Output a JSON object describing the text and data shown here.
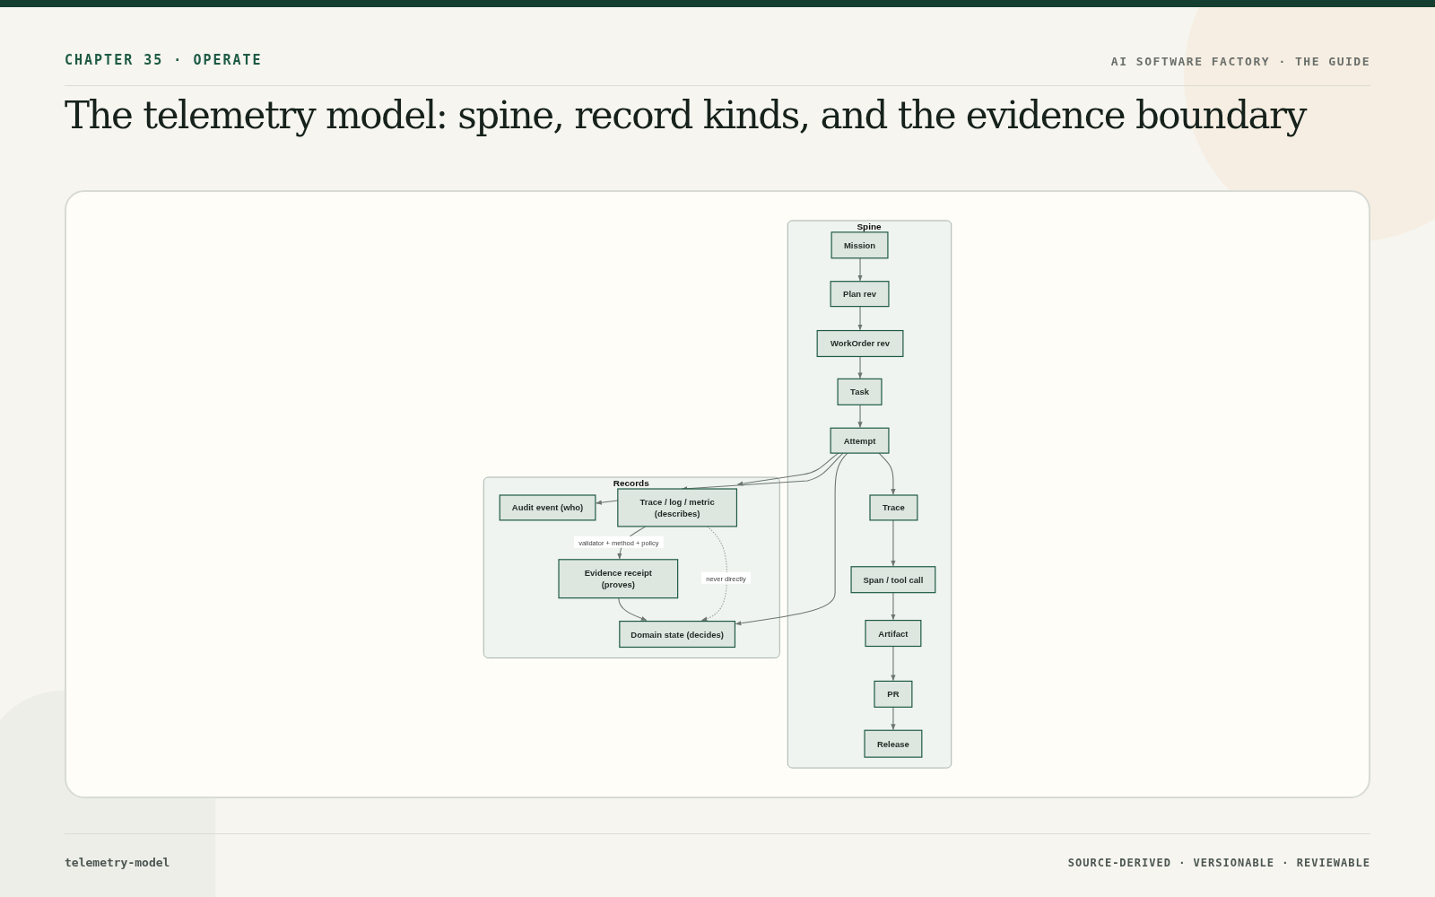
{
  "header": {
    "chapter": "CHAPTER 35 · OPERATE",
    "book": "AI SOFTWARE FACTORY · THE GUIDE"
  },
  "title": "The telemetry model: spine, record kinds, and the evidence boundary",
  "diagram": {
    "spine": {
      "label": "Spine",
      "nodes": [
        {
          "lines": [
            "Mission"
          ]
        },
        {
          "lines": [
            "Plan rev"
          ]
        },
        {
          "lines": [
            "WorkOrder rev"
          ]
        },
        {
          "lines": [
            "Task"
          ]
        },
        {
          "lines": [
            "Attempt"
          ]
        },
        {
          "lines": [
            "Trace"
          ]
        },
        {
          "lines": [
            "Span / tool call"
          ]
        },
        {
          "lines": [
            "Artifact"
          ]
        },
        {
          "lines": [
            "PR"
          ]
        },
        {
          "lines": [
            "Release"
          ]
        }
      ]
    },
    "records": {
      "label": "Records",
      "nodes": [
        {
          "lines": [
            "Audit event (who)"
          ]
        },
        {
          "lines": [
            "Trace / log / metric",
            "(describes)"
          ]
        },
        {
          "lines": [
            "Evidence receipt",
            "(proves)"
          ]
        },
        {
          "lines": [
            "Domain state (decides)"
          ]
        }
      ]
    },
    "edge_labels": [
      "validator + method + policy",
      "never directly"
    ]
  },
  "footer": {
    "slug": "telemetry-model",
    "tags": "SOURCE-DERIVED · VERSIONABLE · REVIEWABLE"
  }
}
